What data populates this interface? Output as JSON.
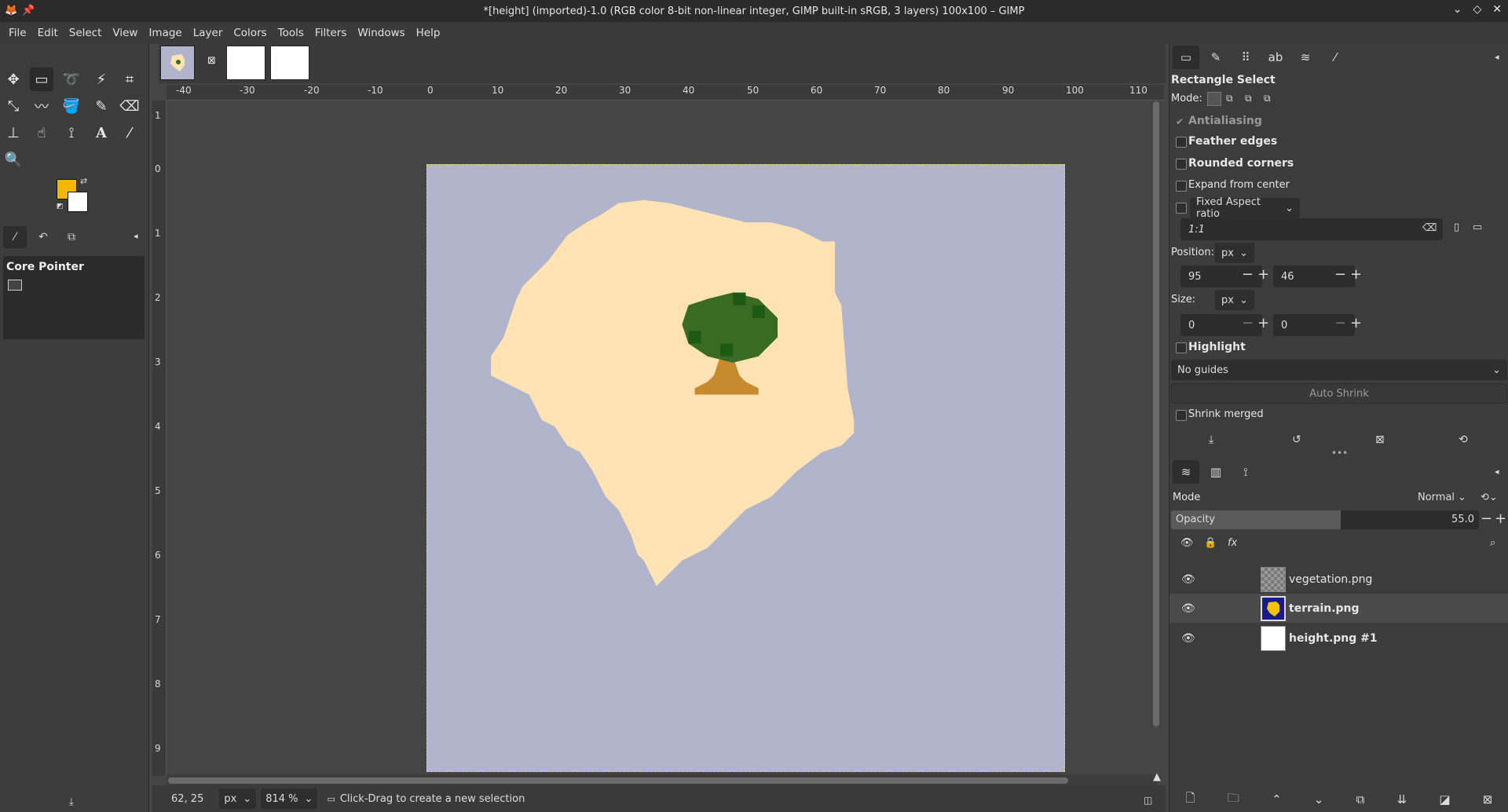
{
  "window": {
    "title": "*[height] (imported)-1.0 (RGB color 8-bit non-linear integer, GIMP built-in sRGB, 3 layers) 100x100 – GIMP"
  },
  "menu": [
    "File",
    "Edit",
    "Select",
    "View",
    "Image",
    "Layer",
    "Colors",
    "Tools",
    "Filters",
    "Windows",
    "Help"
  ],
  "toolbox": {
    "fg_color": "#f5b800",
    "bg_color": "#ffffff",
    "device_panel_title": "Core Pointer"
  },
  "rulers": {
    "top": [
      "-40",
      "-30",
      "-20",
      "-10",
      "0",
      "10",
      "20",
      "30",
      "40",
      "50",
      "60",
      "70",
      "80",
      "90",
      "100",
      "110"
    ],
    "left": [
      "1",
      "0",
      "1",
      "2",
      "3",
      "4",
      "5",
      "6",
      "7",
      "8",
      "9"
    ]
  },
  "status": {
    "coords": "62, 25",
    "unit": "px",
    "zoom": "814 %",
    "message": "Click-Drag to create a new selection"
  },
  "tool_options": {
    "title": "Rectangle Select",
    "mode_label": "Mode:",
    "antialiasing": "Antialiasing",
    "feather_edges": "Feather edges",
    "rounded_corners": "Rounded corners",
    "expand_from_center": "Expand from center",
    "fixed_label": "Fixed Aspect ratio",
    "ratio_value": "1:1",
    "position_label": "Position:",
    "position_unit": "px",
    "position_x": "95",
    "position_y": "46",
    "size_label": "Size:",
    "size_unit": "px",
    "size_w": "0",
    "size_h": "0",
    "highlight": "Highlight",
    "guides": "No guides",
    "auto_shrink": "Auto Shrink",
    "shrink_merged": "Shrink merged"
  },
  "layers": {
    "mode_label": "Mode",
    "mode_value": "Normal",
    "opacity_label": "Opacity",
    "opacity_value": "55.0",
    "opacity_fraction": 0.55,
    "items": [
      {
        "name": "vegetation.png"
      },
      {
        "name": "terrain.png"
      },
      {
        "name": "height.png #1"
      }
    ]
  }
}
